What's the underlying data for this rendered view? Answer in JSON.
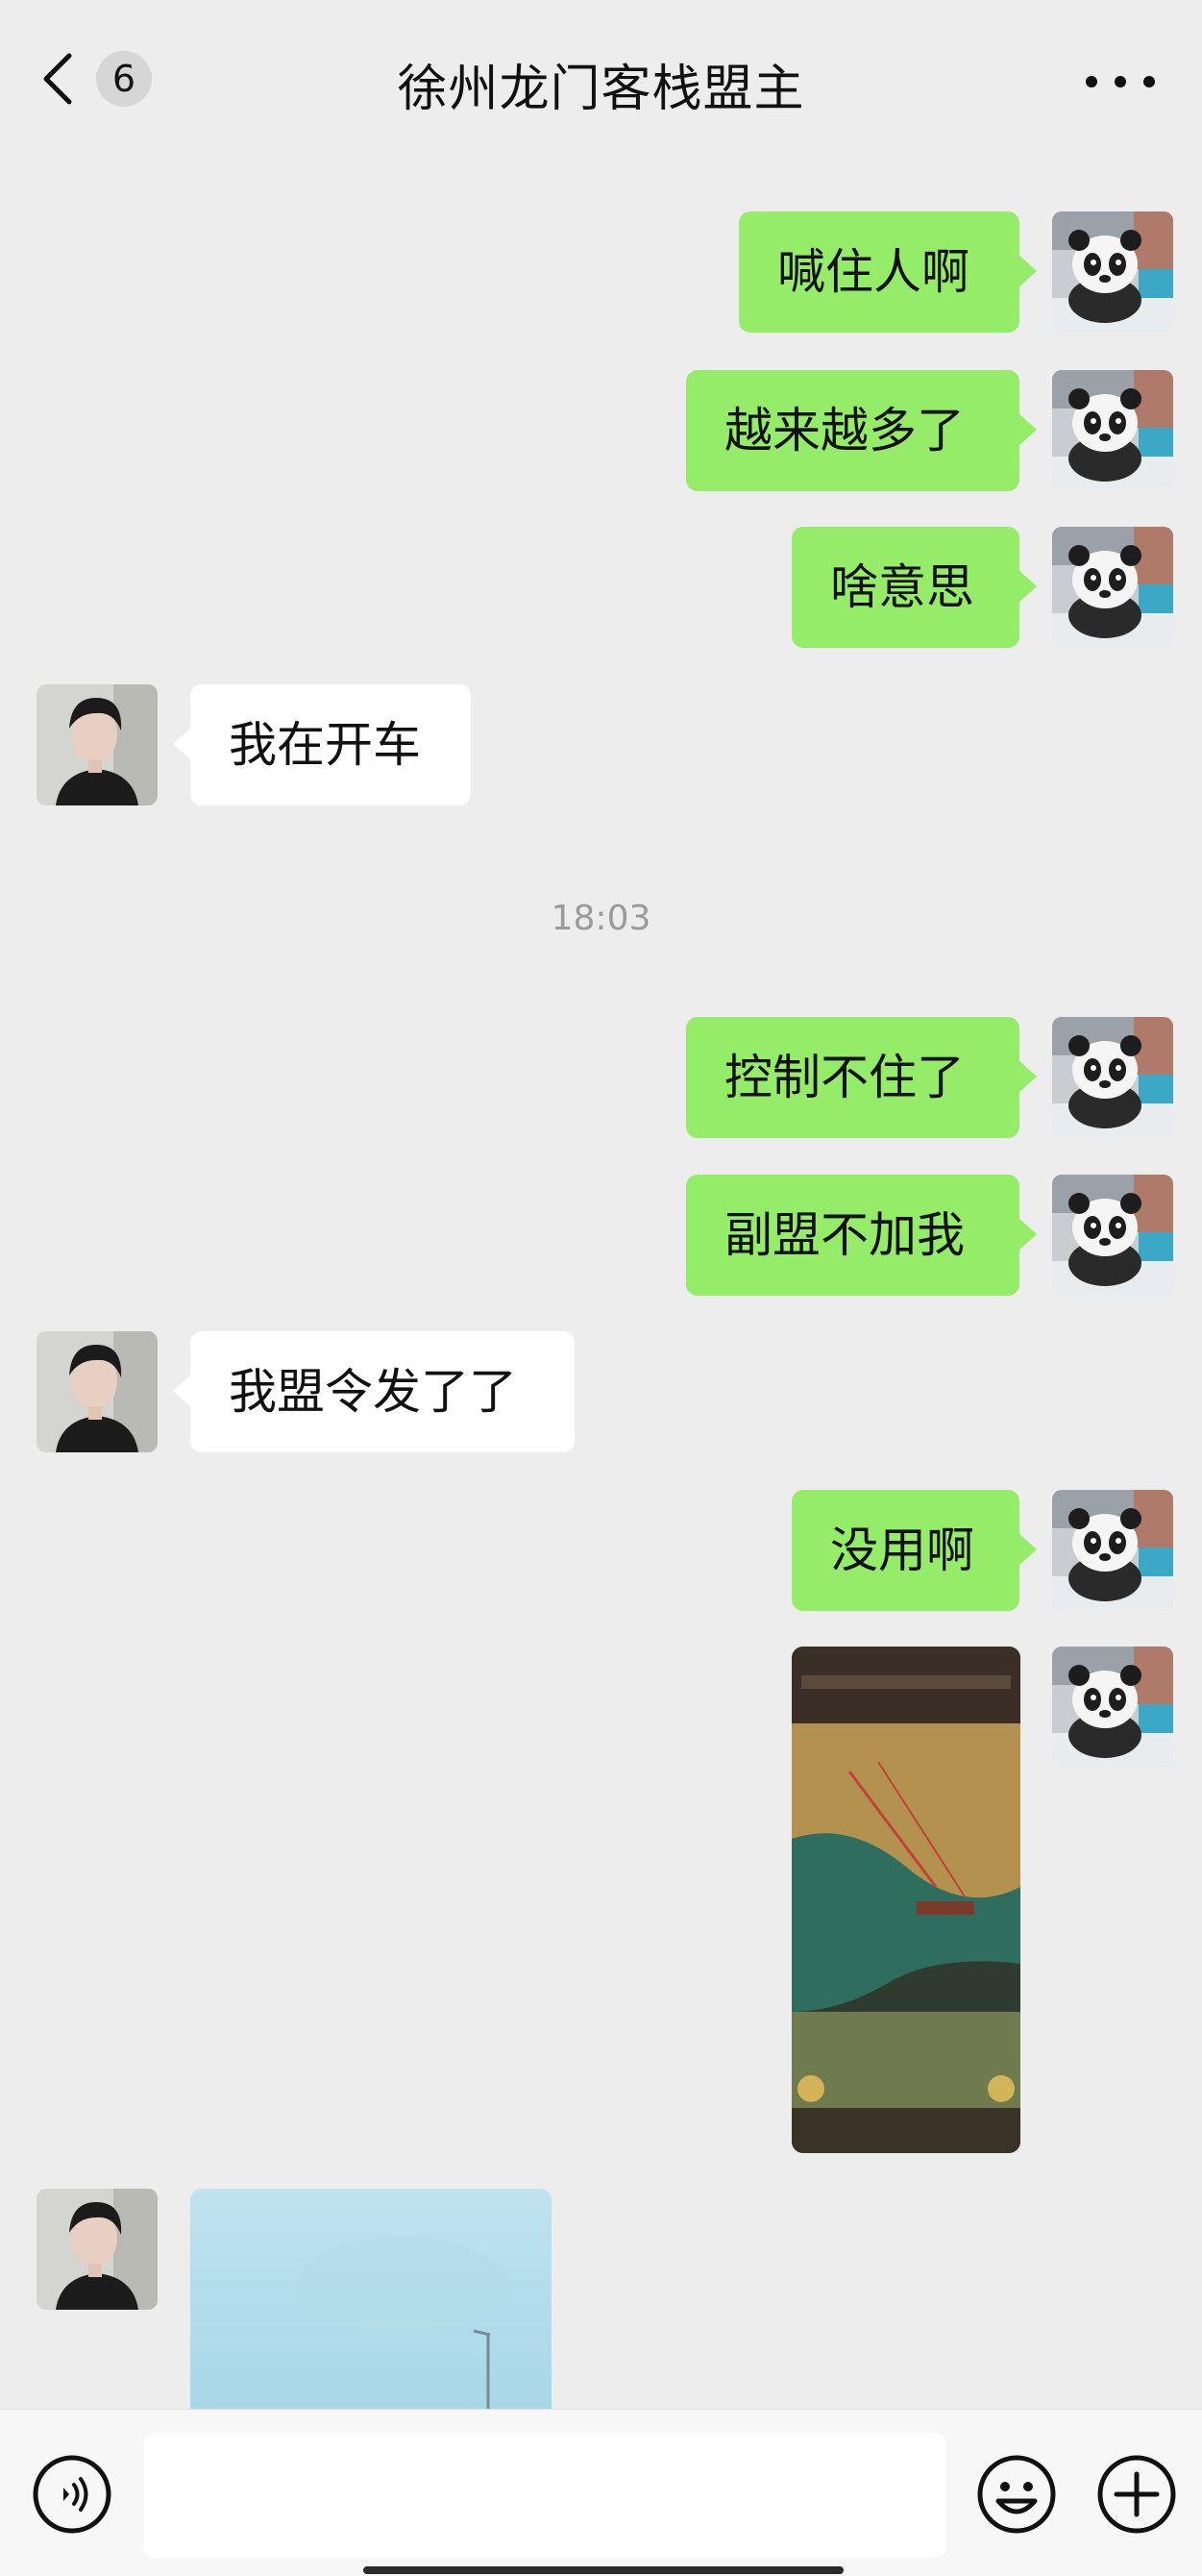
{
  "header": {
    "back_badge": "6",
    "title": "徐州龙门客栈盟主"
  },
  "messages": [
    {
      "side": "right",
      "text": "喊住人啊"
    },
    {
      "side": "right",
      "text": "越来越多了"
    },
    {
      "side": "right",
      "text": "啥意思"
    },
    {
      "side": "left",
      "text": "我在开车"
    },
    {
      "side": "right",
      "text": "控制不住了"
    },
    {
      "side": "right",
      "text": "副盟不加我"
    },
    {
      "side": "left",
      "text": "我盟令发了了"
    },
    {
      "side": "right",
      "text": "没用啊"
    },
    {
      "side": "right",
      "type": "image",
      "content": "game-screenshot"
    },
    {
      "side": "left",
      "type": "image",
      "content": "sky-photo"
    }
  ],
  "timestamp": "18:03",
  "colors": {
    "background": "#ededed",
    "self_bubble": "#95ec69",
    "other_bubble": "#ffffff"
  },
  "icons": {
    "back": "chevron-left-icon",
    "more": "more-dots-icon",
    "voice": "voice-icon",
    "emoji": "emoji-icon",
    "plus": "plus-icon"
  }
}
